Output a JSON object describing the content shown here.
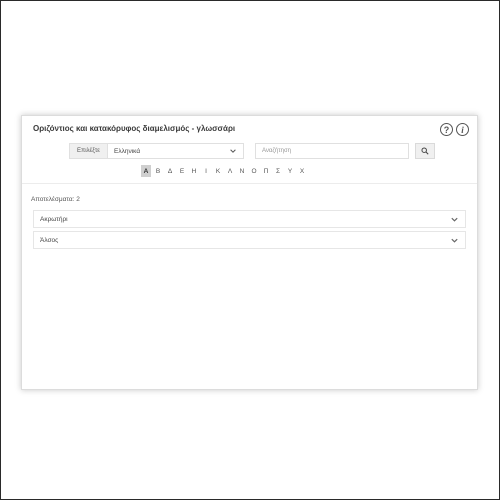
{
  "glossary": {
    "title": "Οριζόντιος και κατακόρυφος διαμελισμός - γλωσσάρι",
    "help_icon": "question-circle-icon",
    "info_icon": "info-circle-icon",
    "language_label": "Επιλέξτε",
    "language_value": "Ελληνικά",
    "search_placeholder": "Αναζήτηση",
    "letters": [
      "Α",
      "Β",
      "Δ",
      "Ε",
      "Η",
      "Ι",
      "Κ",
      "Λ",
      "Ν",
      "Ο",
      "Π",
      "Σ",
      "Υ",
      "Χ"
    ],
    "active_letter": "Α",
    "results_label": "Αποτελέσματα: 2",
    "results": [
      {
        "label": "Ακρωτήρι"
      },
      {
        "label": "Άλσος"
      }
    ]
  }
}
